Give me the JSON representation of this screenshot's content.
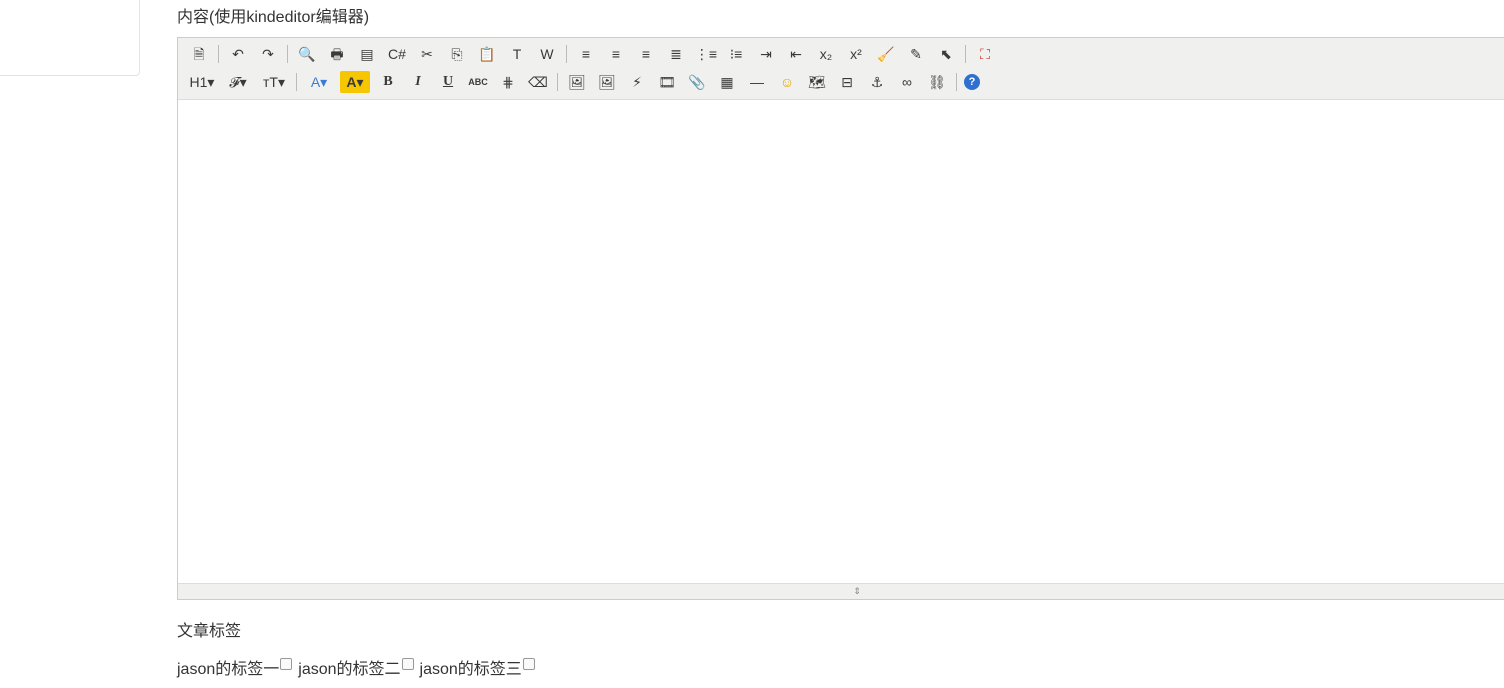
{
  "form": {
    "content_label": "内容(使用kindeditor编辑器)",
    "tags_label": "文章标签"
  },
  "toolbar": {
    "row1": [
      {
        "name": "source-icon",
        "glyph": "🗎"
      },
      {
        "sep": true
      },
      {
        "name": "undo-icon",
        "glyph": "↶"
      },
      {
        "name": "redo-icon",
        "glyph": "↷"
      },
      {
        "sep": true
      },
      {
        "name": "preview-icon",
        "glyph": "🔍"
      },
      {
        "name": "print-icon",
        "glyph": "🖶"
      },
      {
        "name": "template-icon",
        "glyph": "▤"
      },
      {
        "name": "code-icon",
        "glyph": "C#"
      },
      {
        "name": "cut-icon",
        "glyph": "✂"
      },
      {
        "name": "copy-icon",
        "glyph": "⎘"
      },
      {
        "name": "paste-icon",
        "glyph": "📋"
      },
      {
        "name": "plainpaste-icon",
        "glyph": "T"
      },
      {
        "name": "wordpaste-icon",
        "glyph": "W"
      },
      {
        "sep": true
      },
      {
        "name": "justifyleft-icon",
        "glyph": "≡"
      },
      {
        "name": "justifycenter-icon",
        "glyph": "≡"
      },
      {
        "name": "justifyright-icon",
        "glyph": "≡"
      },
      {
        "name": "justifyfull-icon",
        "glyph": "≣"
      },
      {
        "name": "insertorderedlist-icon",
        "glyph": "⋮≡"
      },
      {
        "name": "insertunorderedlist-icon",
        "glyph": "⁝≡"
      },
      {
        "name": "indent-icon",
        "glyph": "⇥"
      },
      {
        "name": "outdent-icon",
        "glyph": "⇤"
      },
      {
        "name": "subscript-icon",
        "glyph": "x₂"
      },
      {
        "name": "superscript-icon",
        "glyph": "x²"
      },
      {
        "name": "clearhtml-icon",
        "glyph": "🧹"
      },
      {
        "name": "quickformat-icon",
        "glyph": "✎"
      },
      {
        "name": "selectall-icon",
        "glyph": "⬉"
      },
      {
        "sep": true
      },
      {
        "name": "fullscreen-icon",
        "glyph": "⛶"
      }
    ],
    "row2": [
      {
        "name": "heading-icon",
        "glyph": "H1▾",
        "wide": true
      },
      {
        "name": "fontname-icon",
        "glyph": "𝓕▾",
        "wide": true
      },
      {
        "name": "fontsize-icon",
        "glyph": "ᴛT▾",
        "wide": true
      },
      {
        "sep": true
      },
      {
        "name": "forecolor-icon",
        "glyph": "A▾",
        "color": "#3a7bd5",
        "wide": true
      },
      {
        "name": "hilitecolor-icon",
        "glyph": "A▾",
        "bg": "#f6c700",
        "wide": true
      },
      {
        "name": "bold-icon",
        "glyph": "B",
        "bold": true
      },
      {
        "name": "italic-icon",
        "glyph": "I",
        "italic": true
      },
      {
        "name": "underline-icon",
        "glyph": "U",
        "underline": true
      },
      {
        "name": "strikethrough-icon",
        "glyph": "ABC"
      },
      {
        "name": "lineheight-icon",
        "glyph": "⋕"
      },
      {
        "name": "removeformat-icon",
        "glyph": "⌫"
      },
      {
        "sep": true
      },
      {
        "name": "image-icon",
        "glyph": "🖼"
      },
      {
        "name": "multiimage-icon",
        "glyph": "🖼"
      },
      {
        "name": "flash-icon",
        "glyph": "⚡"
      },
      {
        "name": "media-icon",
        "glyph": "🎞"
      },
      {
        "name": "insertfile-icon",
        "glyph": "📎"
      },
      {
        "name": "table-icon",
        "glyph": "▦"
      },
      {
        "name": "hr-icon",
        "glyph": "―"
      },
      {
        "name": "emoticons-icon",
        "glyph": "☺"
      },
      {
        "name": "baidumap-icon",
        "glyph": "🗺"
      },
      {
        "name": "pagebreak-icon",
        "glyph": "⊟"
      },
      {
        "name": "anchor-icon",
        "glyph": "⚓"
      },
      {
        "name": "link-icon",
        "glyph": "∞"
      },
      {
        "name": "unlink-icon",
        "glyph": "⛓"
      },
      {
        "sep": true
      },
      {
        "name": "help-icon",
        "glyph": "?"
      }
    ]
  },
  "tags": [
    {
      "label": "jason的标签一",
      "checked": false
    },
    {
      "label": "jason的标签二",
      "checked": false
    },
    {
      "label": "jason的标签三",
      "checked": false
    }
  ],
  "colors": {
    "toolbar_bg": "#f0f0ee",
    "border": "#cccccc",
    "forecolor": "#3a7bd5",
    "hilitecolor": "#f6c700",
    "help_icon": "#2f6fd0"
  }
}
